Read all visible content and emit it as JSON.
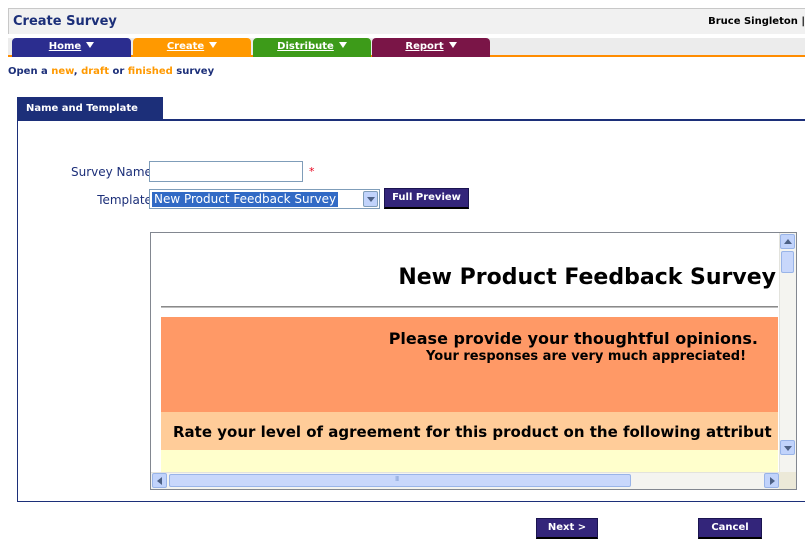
{
  "app": {
    "title": "Create Survey",
    "user": "Bruce Singleton |"
  },
  "nav": {
    "tabs": [
      {
        "label": "Home",
        "color": "#2b2d8f"
      },
      {
        "label": "Create",
        "color": "#ff9900"
      },
      {
        "label": "Distribute",
        "color": "#3d9b19"
      },
      {
        "label": "Report",
        "color": "#7a1547"
      }
    ]
  },
  "subnav": {
    "prefix": "Open a ",
    "new": "new",
    "comma": ", ",
    "draft": "draft",
    "or": " or ",
    "finished": "finished",
    "suffix": " survey"
  },
  "panel": {
    "tab_label": "Name and Template"
  },
  "form": {
    "survey_name_label": "Survey Name:",
    "survey_name_value": "",
    "required_mark": "*",
    "template_label": "Template:",
    "template_value": "New Product Feedback Survey",
    "full_preview_label": "Full Preview"
  },
  "preview": {
    "title": "New Product Feedback Survey",
    "message_line1": "Please provide your thoughtful opinions.",
    "message_line2": "Your responses are very much appreciated!",
    "question": "Rate your level of agreement for this product on the following attribut"
  },
  "footer": {
    "next_label": "Next >",
    "cancel_label": "Cancel"
  },
  "colors": {
    "brand_navy": "#1c2f79",
    "accent_orange": "#ff9900",
    "button_purple": "#33257a"
  }
}
